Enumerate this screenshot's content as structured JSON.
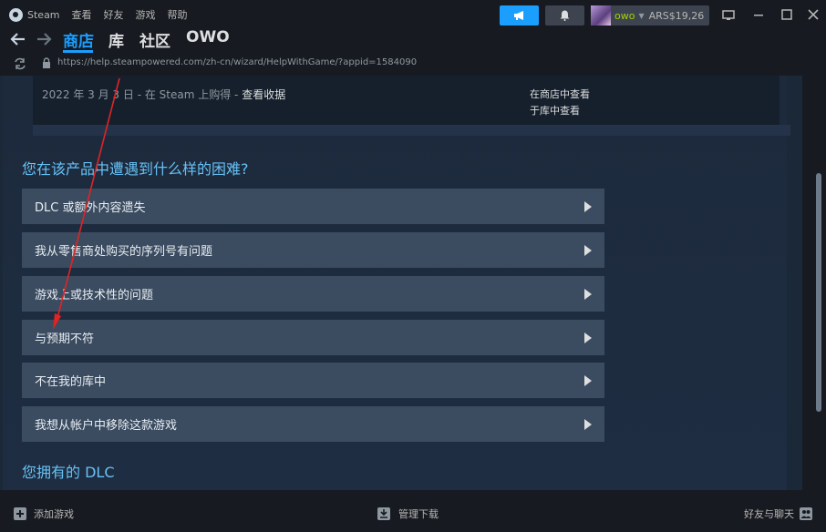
{
  "window": {
    "app_name": "Steam",
    "menu": [
      "查看",
      "好友",
      "游戏",
      "帮助"
    ]
  },
  "header": {
    "username": "owo",
    "balance": "ARS$19,26"
  },
  "nav": {
    "tabs": [
      "商店",
      "库",
      "社区",
      "OWO"
    ],
    "active_tab": "商店"
  },
  "url": "https://help.steampowered.com/zh-cn/wizard/HelpWithGame/?appid=1584090",
  "purchase": {
    "date_text": "2022 年 3 月 3 日 - 在 Steam 上购得 - ",
    "receipt_link": "查看收据",
    "store_link": "在商店中查看",
    "library_link": "于库中查看"
  },
  "main": {
    "question": "您在该产品中遭遇到什么样的困难?",
    "options": [
      "DLC 或额外内容遗失",
      "我从零售商处购买的序列号有问题",
      "游戏上或技术性的问题",
      "与预期不符",
      "不在我的库中",
      "我想从帐户中移除这款游戏"
    ],
    "dlc_heading": "您拥有的 DLC"
  },
  "footer": {
    "add_game": "添加游戏",
    "manage_downloads": "管理下载",
    "friends_chat": "好友与聊天"
  },
  "colors": {
    "accent": "#1a9fff",
    "link_blue": "#67c1f5",
    "option_bg": "#3b4b60",
    "annotation": "#e02424"
  }
}
